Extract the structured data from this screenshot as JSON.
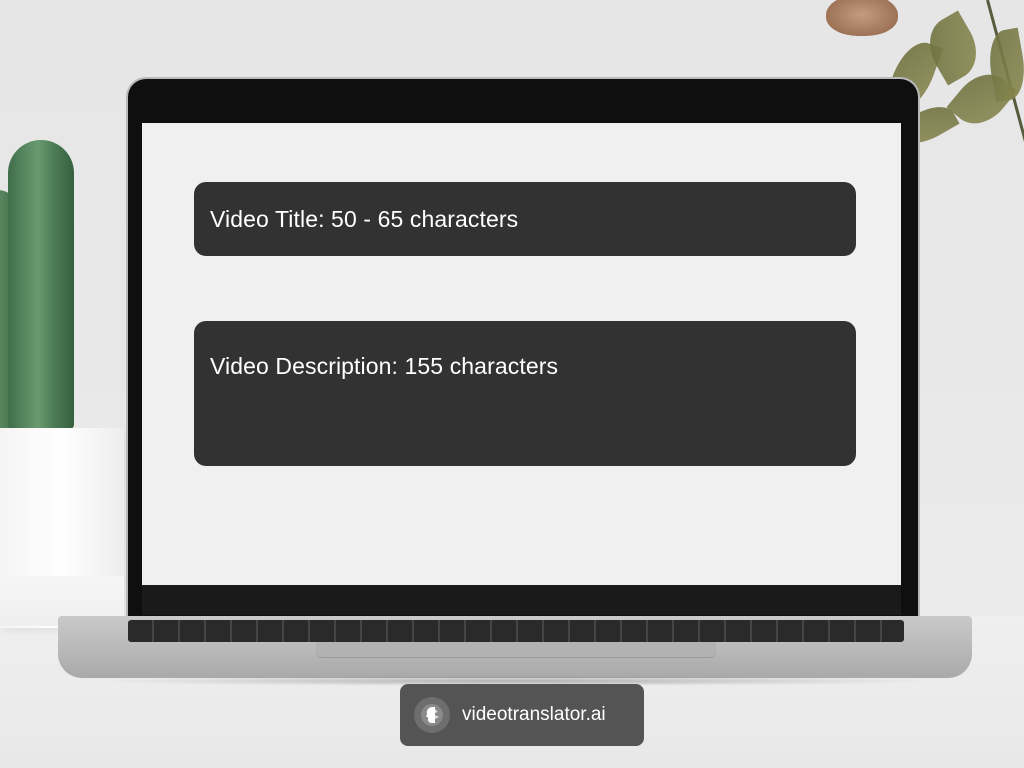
{
  "screen": {
    "cards": [
      {
        "label": "Video Title: 50 - 65 characters"
      },
      {
        "label": "Video Description: 155 characters"
      }
    ]
  },
  "brand": {
    "name": "videotranslator.ai",
    "logo_icon": "face-profile-icon"
  },
  "colors": {
    "card_background": "#323232",
    "screen_background": "#f0f0f0",
    "badge_background": "#545454"
  }
}
